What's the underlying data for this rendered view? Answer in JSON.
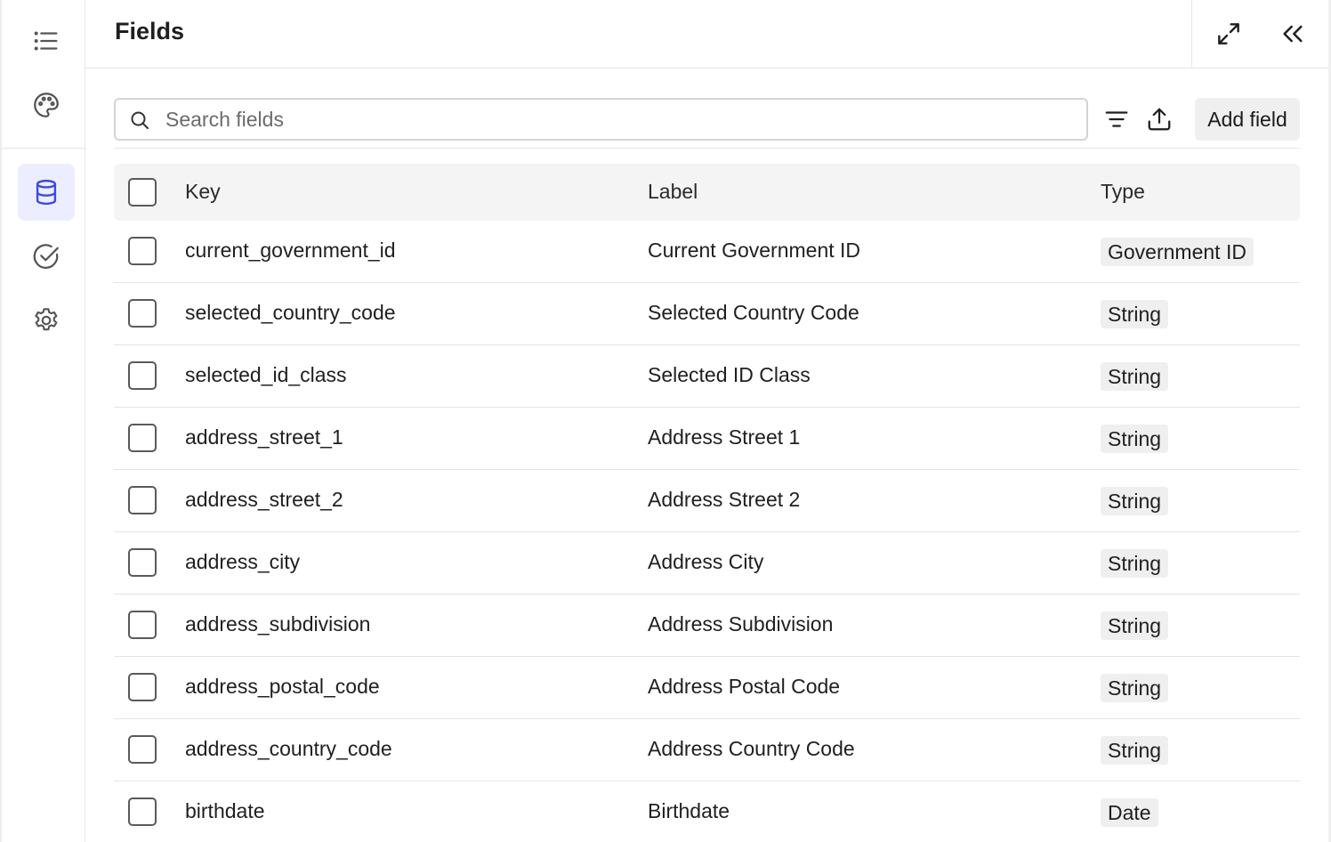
{
  "header": {
    "title": "Fields"
  },
  "search": {
    "placeholder": "Search fields",
    "value": ""
  },
  "toolbar": {
    "add_label": "Add field"
  },
  "table": {
    "columns": {
      "key": "Key",
      "label": "Label",
      "type": "Type"
    },
    "rows": [
      {
        "key": "current_government_id",
        "label": "Current Government ID",
        "type": "Government ID"
      },
      {
        "key": "selected_country_code",
        "label": "Selected Country Code",
        "type": "String"
      },
      {
        "key": "selected_id_class",
        "label": "Selected ID Class",
        "type": "String"
      },
      {
        "key": "address_street_1",
        "label": "Address Street 1",
        "type": "String"
      },
      {
        "key": "address_street_2",
        "label": "Address Street 2",
        "type": "String"
      },
      {
        "key": "address_city",
        "label": "Address City",
        "type": "String"
      },
      {
        "key": "address_subdivision",
        "label": "Address Subdivision",
        "type": "String"
      },
      {
        "key": "address_postal_code",
        "label": "Address Postal Code",
        "type": "String"
      },
      {
        "key": "address_country_code",
        "label": "Address Country Code",
        "type": "String"
      },
      {
        "key": "birthdate",
        "label": "Birthdate",
        "type": "Date"
      }
    ]
  },
  "icons": {
    "rail": [
      "list-icon",
      "palette-icon",
      "database-icon",
      "check-circle-icon",
      "gear-icon"
    ],
    "header": [
      "expand-icon",
      "collapse-icon"
    ],
    "tools": [
      "search-icon",
      "filter-icon",
      "upload-icon"
    ]
  },
  "colors": {
    "accent": "#3b4bdb",
    "active_bg": "#eceeff",
    "icon": "#555555"
  }
}
